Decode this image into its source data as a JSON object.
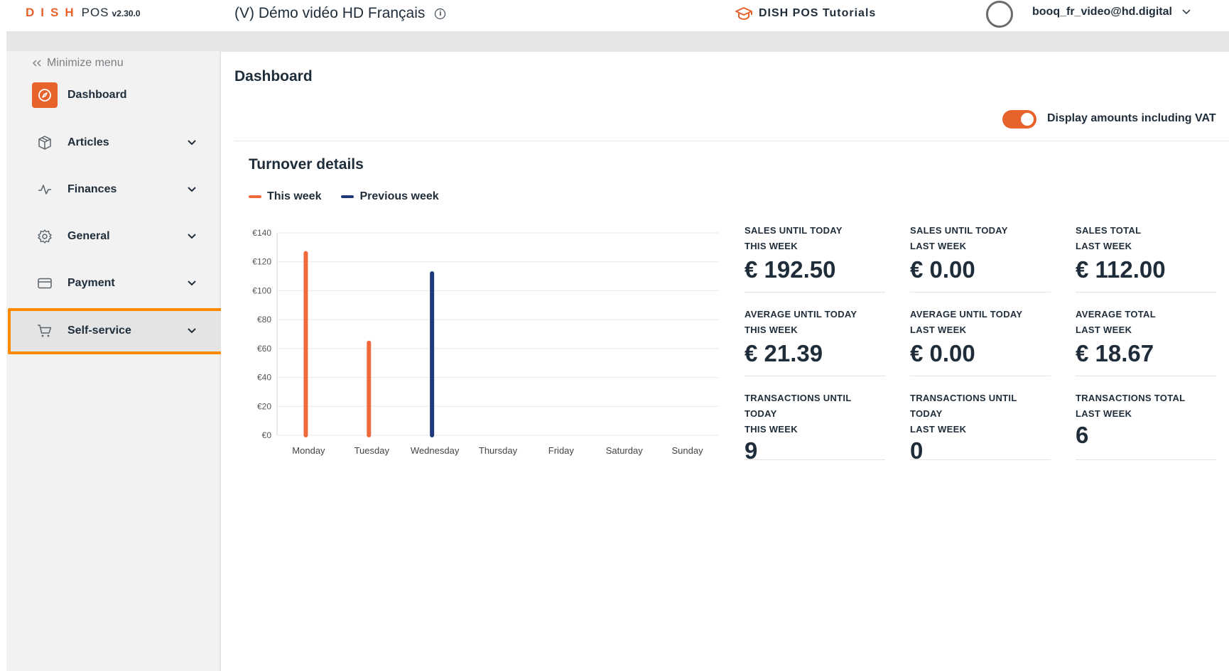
{
  "header": {
    "logo_dish": "DISH",
    "logo_pos": "POS",
    "version": "v2.30.0",
    "venue_name": "(V) Démo vidéo HD Français",
    "tutorials_label": "DISH POS Tutorials",
    "user_email": "booq_fr_video@hd.digital"
  },
  "sidebar": {
    "minimize_label": "Minimize menu",
    "items": [
      {
        "label": "Dashboard",
        "icon": "compass-icon"
      },
      {
        "label": "Articles",
        "icon": "box-icon"
      },
      {
        "label": "Finances",
        "icon": "pulse-icon"
      },
      {
        "label": "General",
        "icon": "gear-icon"
      },
      {
        "label": "Payment",
        "icon": "card-icon"
      },
      {
        "label": "Self-service",
        "icon": "cart-icon"
      }
    ]
  },
  "main": {
    "page_title": "Dashboard",
    "vat_label": "Display amounts including VAT",
    "vat_enabled": true,
    "section_title": "Turnover details",
    "legend": {
      "this_week": "This week",
      "previous_week": "Previous week"
    }
  },
  "colors": {
    "accent": "#e8632b",
    "this_week": "#ee6a3d",
    "previous_week": "#1f3a7a",
    "highlight": "#ff8a00"
  },
  "chart_data": {
    "type": "bar",
    "categories": [
      "Monday",
      "Tuesday",
      "Wednesday",
      "Thursday",
      "Friday",
      "Saturday",
      "Sunday"
    ],
    "series": [
      {
        "name": "This week",
        "values": [
          126,
          64,
          null,
          null,
          null,
          null,
          null
        ]
      },
      {
        "name": "Previous week",
        "values": [
          null,
          null,
          112,
          null,
          null,
          null,
          null
        ]
      }
    ],
    "yticks": [
      "€0",
      "€20",
      "€40",
      "€60",
      "€80",
      "€100",
      "€120",
      "€140"
    ],
    "ylim": [
      0,
      140
    ],
    "grid": true
  },
  "stats": [
    {
      "label_lines": [
        "SALES UNTIL TODAY",
        "THIS WEEK"
      ],
      "value": "€ 192.50"
    },
    {
      "label_lines": [
        "SALES UNTIL TODAY",
        "LAST WEEK"
      ],
      "value": "€ 0.00"
    },
    {
      "label_lines": [
        "SALES TOTAL",
        "LAST WEEK"
      ],
      "value": "€ 112.00"
    },
    {
      "label_lines": [
        "AVERAGE UNTIL TODAY",
        "THIS WEEK"
      ],
      "value": "€ 21.39"
    },
    {
      "label_lines": [
        "AVERAGE UNTIL TODAY",
        "LAST WEEK"
      ],
      "value": "€ 0.00"
    },
    {
      "label_lines": [
        "AVERAGE TOTAL",
        "LAST WEEK"
      ],
      "value": "€ 18.67"
    },
    {
      "label_lines": [
        "TRANSACTIONS UNTIL",
        "TODAY",
        "THIS WEEK"
      ],
      "value": "9"
    },
    {
      "label_lines": [
        "TRANSACTIONS UNTIL",
        "TODAY",
        "LAST WEEK"
      ],
      "value": "0"
    },
    {
      "label_lines": [
        "TRANSACTIONS TOTAL",
        "LAST WEEK"
      ],
      "value": "6"
    }
  ]
}
